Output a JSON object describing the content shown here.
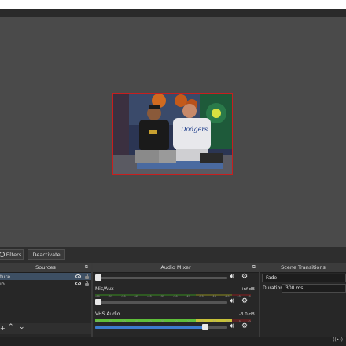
{
  "toolbar": {
    "filters_label": "Filters",
    "deactivate_label": "Deactivate"
  },
  "sources": {
    "title": "Sources",
    "items": [
      {
        "label": "ture",
        "selected": true
      },
      {
        "label": "io",
        "selected": false
      }
    ],
    "bottom_icons": [
      "add-icon",
      "move-up-icon",
      "move-down-icon"
    ]
  },
  "audio_mixer": {
    "title": "Audio Mixer",
    "channels": [
      {
        "name": "",
        "db": "",
        "level": 0
      },
      {
        "name": "Mic/Aux",
        "db": "-inf dB",
        "level": 0
      },
      {
        "name": "VHS Audio",
        "db": "-3.0 dB",
        "level": 0.82
      }
    ],
    "ticks": [
      "-60",
      "-55",
      "-50",
      "-45",
      "-40",
      "-35",
      "-30",
      "-25",
      "-20",
      "-15",
      "-10",
      "-5",
      "0"
    ]
  },
  "scene_transitions": {
    "title": "Scene Transitions",
    "transition": "Fade",
    "duration_label": "Duration",
    "duration_value": "300 ms"
  },
  "colors": {
    "preview_border": "#c81e1e",
    "accent": "#3c7ccf",
    "meter_green": "#5fbf3a",
    "meter_yellow": "#c8c23a",
    "meter_red": "#c83a3a"
  }
}
